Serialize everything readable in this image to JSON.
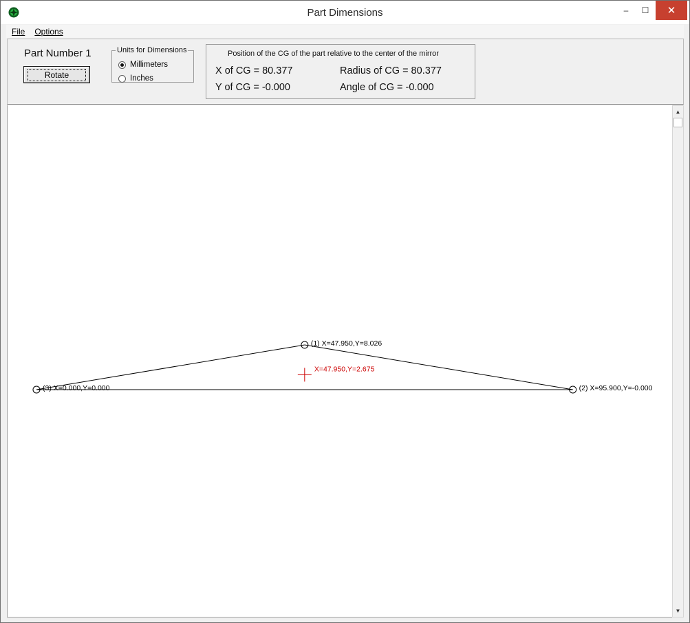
{
  "window": {
    "title": "Part Dimensions"
  },
  "titlebar_buttons": {
    "minimize": "–",
    "maximize": "☐",
    "close": "✕"
  },
  "menu": {
    "file": "File",
    "options": "Options"
  },
  "panel": {
    "part_number": "Part Number 1",
    "rotate_label": "Rotate",
    "units_legend": "Units for Dimensions",
    "units_options": [
      {
        "label": "Millimeters",
        "selected": true
      },
      {
        "label": "Inches",
        "selected": false
      }
    ]
  },
  "cg": {
    "title": "Position of the CG of the part relative to the center of the mirror",
    "x_cg": "X of CG = 80.377",
    "y_cg": "Y of CG = -0.000",
    "radius_cg": "Radius of CG = 80.377",
    "angle_cg": "Angle of CG = -0.000"
  },
  "drawing": {
    "points": [
      {
        "id": 1,
        "x": 47.95,
        "y": 8.026,
        "label": "(1) X=47.950,Y=8.026"
      },
      {
        "id": 2,
        "x": 95.9,
        "y": -0.0,
        "label": "(2) X=95.900,Y=-0.000"
      },
      {
        "id": 3,
        "x": 0.0,
        "y": 0.0,
        "label": "(3) X=0.000,Y=0.000"
      }
    ],
    "cg_marker": {
      "x": 47.95,
      "y": 2.675,
      "label": "X=47.950,Y=2.675",
      "color": "#cc0000"
    }
  },
  "colors": {
    "close_button": "#c7402f",
    "app_icon": "#1f9e3a",
    "cg_marker": "#cc0000"
  }
}
